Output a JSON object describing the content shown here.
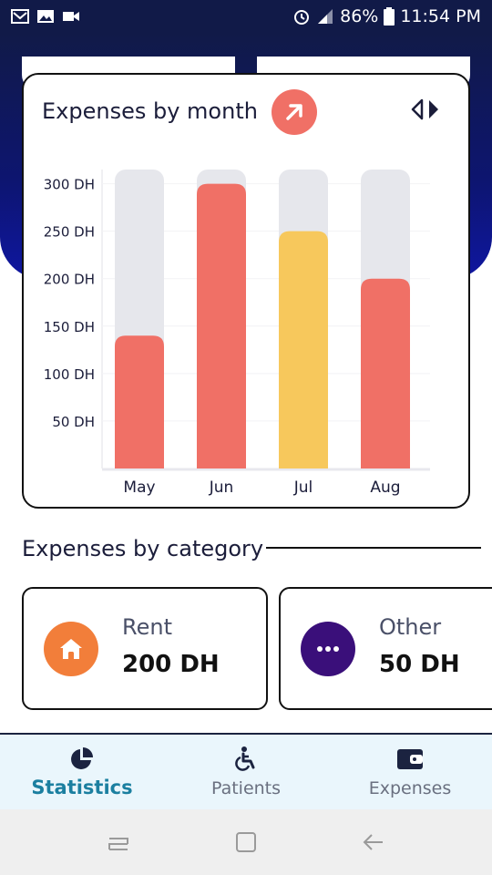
{
  "status_bar": {
    "battery": "86%",
    "time": "11:54 PM"
  },
  "chart_card": {
    "title": "Expenses by month"
  },
  "chart_data": {
    "type": "bar",
    "categories": [
      "May",
      "Jun",
      "Jul",
      "Aug"
    ],
    "values": [
      140,
      300,
      250,
      200
    ],
    "ylim": [
      0,
      315
    ],
    "yticks": [
      50,
      100,
      150,
      200,
      250,
      300
    ],
    "tick_suffix": " DH",
    "highlight_index": 2,
    "colors": {
      "bar": "#f07066",
      "highlight": "#f7c85c",
      "track": "#e6e7ec"
    }
  },
  "categories_section": {
    "heading": "Expenses by category",
    "items": [
      {
        "name": "Rent",
        "amount": "200 DH",
        "icon": "home-icon",
        "color": "#f27e3a"
      },
      {
        "name": "Other",
        "amount": "50 DH",
        "icon": "more-dots-icon",
        "color": "#3a0f7a"
      }
    ]
  },
  "bottom_nav": {
    "items": [
      {
        "label": "Statistics",
        "icon": "pie-chart-icon",
        "active": true
      },
      {
        "label": "Patients",
        "icon": "wheelchair-icon",
        "active": false
      },
      {
        "label": "Expenses",
        "icon": "wallet-icon",
        "active": false
      }
    ]
  }
}
